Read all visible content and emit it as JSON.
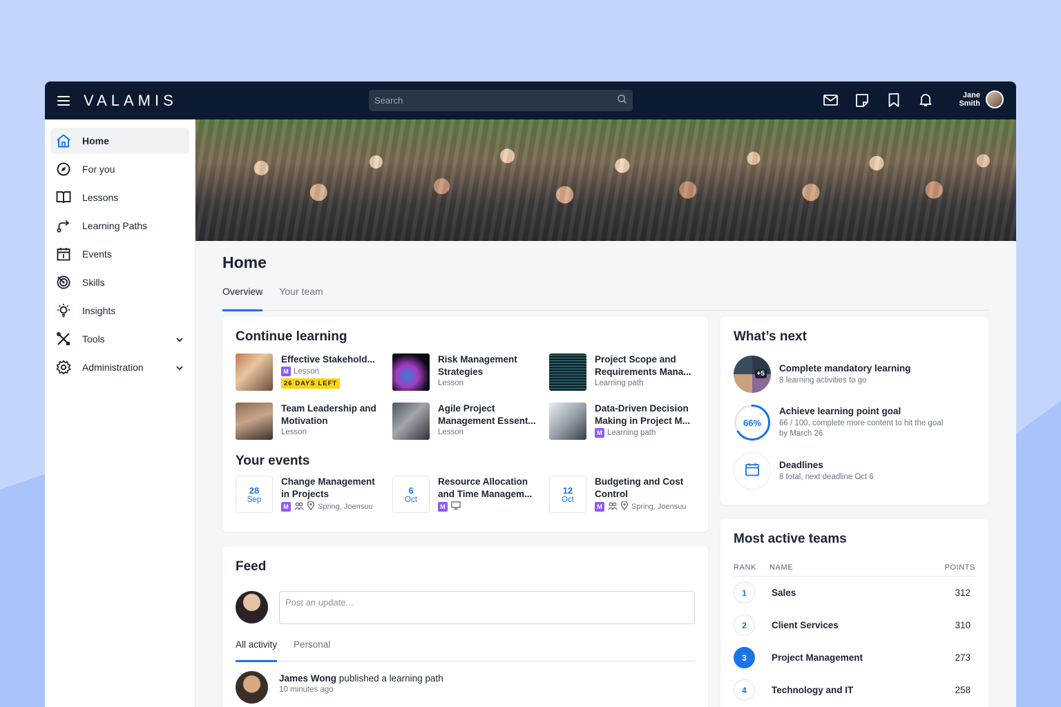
{
  "app": {
    "logo": "VALAMIS"
  },
  "search": {
    "placeholder": "Search"
  },
  "user": {
    "first": "Jane",
    "last": "Smith"
  },
  "sidebar": {
    "items": [
      {
        "label": "Home",
        "icon": "home-icon",
        "active": true
      },
      {
        "label": "For you",
        "icon": "compass-icon"
      },
      {
        "label": "Lessons",
        "icon": "book-icon"
      },
      {
        "label": "Learning Paths",
        "icon": "path-icon"
      },
      {
        "label": "Events",
        "icon": "calendar-icon"
      },
      {
        "label": "Skills",
        "icon": "target-icon"
      },
      {
        "label": "Insights",
        "icon": "lightbulb-icon"
      },
      {
        "label": "Tools",
        "icon": "tools-icon",
        "expandable": true
      },
      {
        "label": "Administration",
        "icon": "gear-icon",
        "expandable": true
      }
    ]
  },
  "main": {
    "title": "Home",
    "tabs": [
      {
        "label": "Overview",
        "active": true
      },
      {
        "label": "Your team"
      }
    ]
  },
  "continue_learning": {
    "title": "Continue learning",
    "items": [
      {
        "title": "Effective Stakehold...",
        "type": "Lesson",
        "badge": "M",
        "deadline": "26 DAYS LEFT"
      },
      {
        "title": "Risk Management Strategies",
        "type": "Lesson"
      },
      {
        "title": "Project Scope and Requirements Mana...",
        "type": "Learning path"
      },
      {
        "title": "Team Leadership and Motivation",
        "type": "Lesson"
      },
      {
        "title": "Agile Project Management Essent...",
        "type": "Lesson"
      },
      {
        "title": "Data-Driven Decision Making in Project M...",
        "type": "Learning path",
        "badge": "M"
      }
    ]
  },
  "events": {
    "title": "Your events",
    "items": [
      {
        "day": "28",
        "month": "Sep",
        "title": "Change Management in Projects",
        "badge": "M",
        "location": "Spring, Joensuu"
      },
      {
        "day": "6",
        "month": "Oct",
        "title": "Resource Allocation and Time Managem...",
        "badge": "M"
      },
      {
        "day": "12",
        "month": "Oct",
        "title": "Budgeting and Cost Control",
        "badge": "M",
        "location": "Spring, Joensuu"
      }
    ]
  },
  "feed": {
    "title": "Feed",
    "placeholder": "Post an update...",
    "tabs": [
      {
        "label": "All activity",
        "active": true
      },
      {
        "label": "Personal"
      }
    ],
    "activity": {
      "user": "James Wong",
      "action": "published a learning path",
      "time": "10 minutes ago"
    }
  },
  "whats_next": {
    "title": "What’s next",
    "items": [
      {
        "title": "Complete mandatory learning",
        "sub": "8 learning activities to go",
        "more": "+5"
      },
      {
        "title": "Achieve learning point goal",
        "sub": "66 / 100, complete more content to hit the goal by March 26",
        "percent": "66%",
        "progress": 0.66
      },
      {
        "title": "Deadlines",
        "sub": "8 total, next deadline Oct 6"
      }
    ]
  },
  "teams": {
    "title": "Most active teams",
    "headers": {
      "rank": "RANK",
      "name": "NAME",
      "points": "POINTS"
    },
    "rows": [
      {
        "rank": "1",
        "name": "Sales",
        "points": "312"
      },
      {
        "rank": "2",
        "name": "Client Services",
        "points": "310"
      },
      {
        "rank": "3",
        "name": "Project Management",
        "points": "273",
        "highlight": true
      },
      {
        "rank": "4",
        "name": "Technology and IT",
        "points": "258"
      }
    ]
  },
  "colors": {
    "topbar": "#0b1a30",
    "accent": "#1a73e8",
    "badge": "#8b5cf6",
    "deadline": "#ffd60a"
  }
}
